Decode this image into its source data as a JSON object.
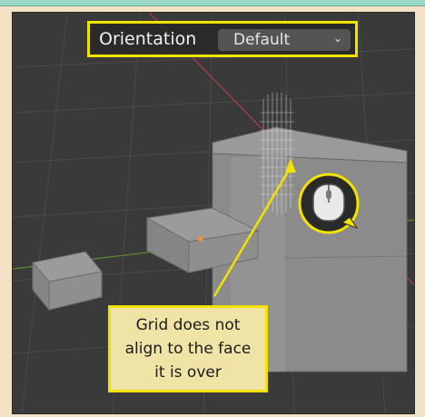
{
  "toolbar": {
    "orientation_label": "Orientation",
    "orientation_value": "Default",
    "dropdown_icon": "chevron-down-icon"
  },
  "annotation": {
    "line1": "Grid does not",
    "line2": "align to the face",
    "line3": "it is over"
  },
  "icons": {
    "mouse": "mouse-middle-button-icon"
  },
  "colors": {
    "highlight": "#f2e200",
    "callout_bg": "#efe3a6",
    "viewport_bg": "#3a3a3a",
    "page_bg": "#f3e3c6",
    "axis_x": "#b43a4a",
    "axis_y": "#5f8f2a",
    "origin_dot": "#e8923a"
  }
}
